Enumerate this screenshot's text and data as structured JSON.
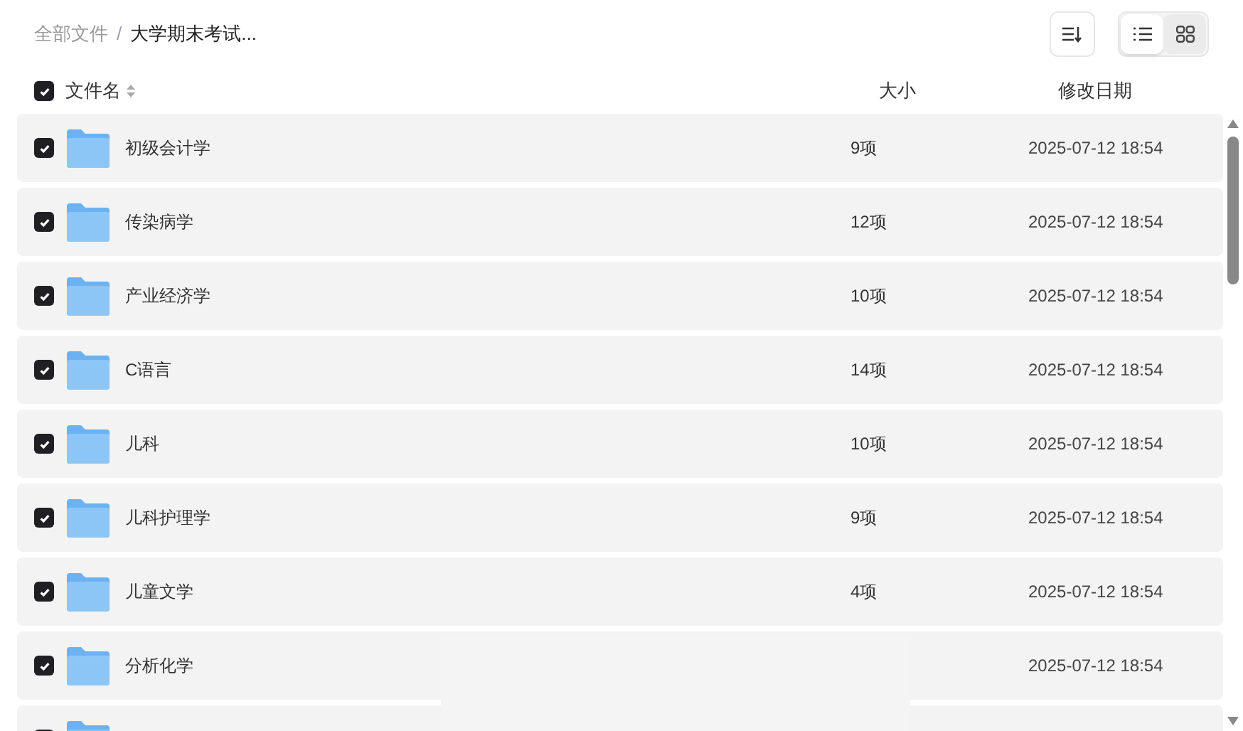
{
  "breadcrumb": [
    {
      "label": "全部文件",
      "selected": false
    },
    {
      "label": "大学期末考试...",
      "selected": true
    }
  ],
  "breadcrumb_separator": "/",
  "view_toggle": [
    {
      "kind": "list",
      "selected": true
    },
    {
      "kind": "grid",
      "selected": false
    }
  ],
  "header": {
    "checked": true,
    "name": "文件名",
    "size": "大小",
    "date": "修改日期"
  },
  "rows": [
    {
      "name": "初级会计学",
      "size": "9项",
      "date": "2025-07-12 18:54",
      "checked": true
    },
    {
      "name": "传染病学",
      "size": "12项",
      "date": "2025-07-12 18:54",
      "checked": true
    },
    {
      "name": "产业经济学",
      "size": "10项",
      "date": "2025-07-12 18:54",
      "checked": true
    },
    {
      "name": "C语言",
      "size": "14项",
      "date": "2025-07-12 18:54",
      "checked": true
    },
    {
      "name": "儿科",
      "size": "10项",
      "date": "2025-07-12 18:54",
      "checked": true
    },
    {
      "name": "儿科护理学",
      "size": "9项",
      "date": "2025-07-12 18:54",
      "checked": true
    },
    {
      "name": "儿童文学",
      "size": "4项",
      "date": "2025-07-12 18:54",
      "checked": true
    },
    {
      "name": "分析化学",
      "date": "2025-07-12 18:54",
      "checked": true
    },
    {
      "checked": true
    }
  ]
}
